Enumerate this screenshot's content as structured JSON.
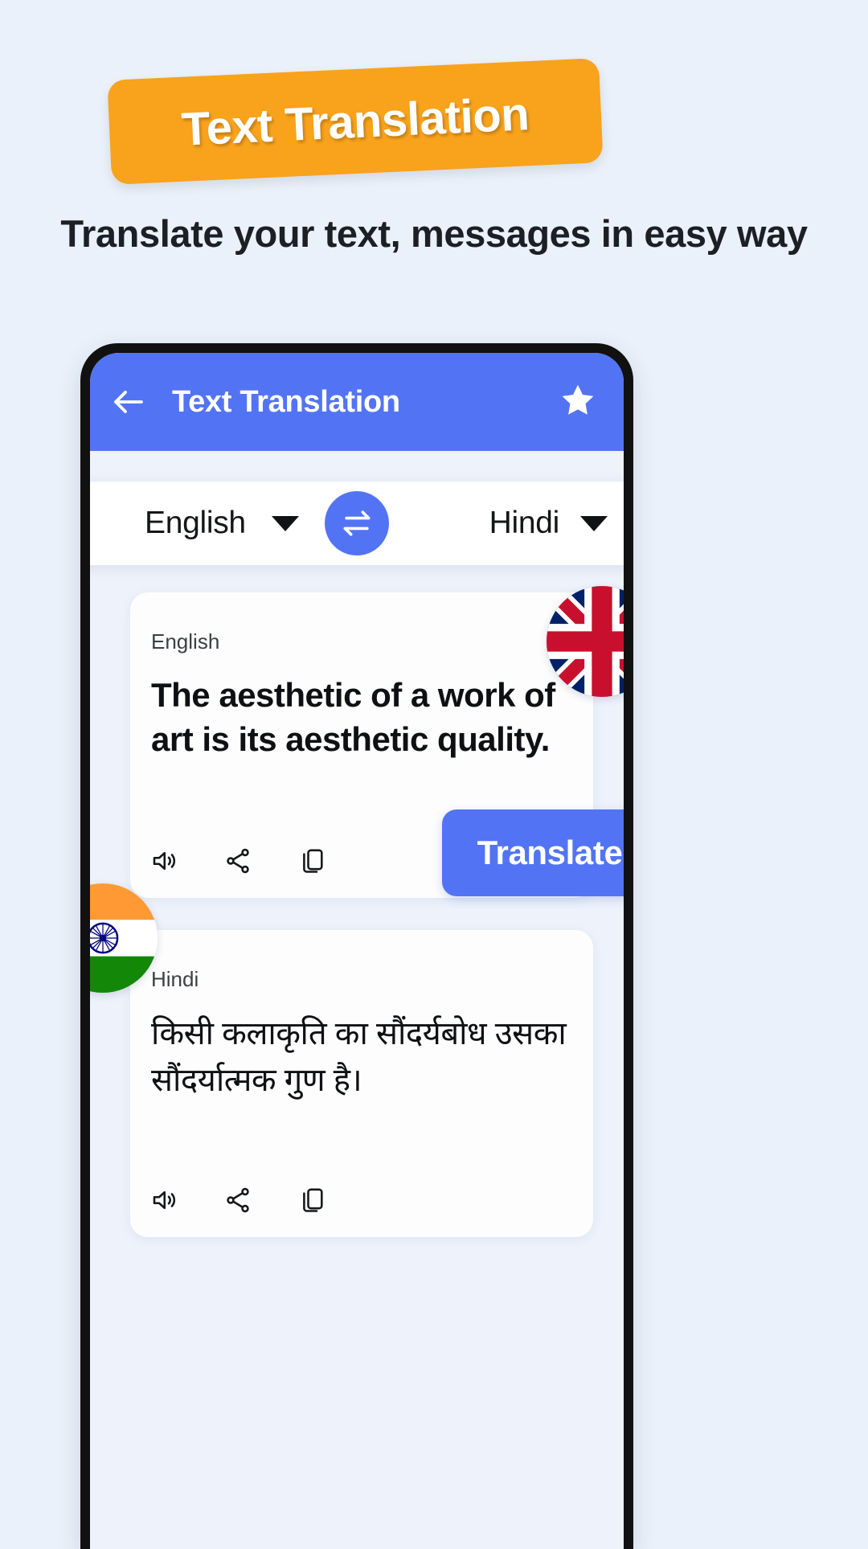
{
  "promo": {
    "banner_title": "Text Translation",
    "subtitle": "Translate your text, messages in easy way",
    "banner_color": "#F9A21B",
    "background_color": "#EAF1FA"
  },
  "app": {
    "accent_color": "#5274F4",
    "app_bar": {
      "title": "Text Translation",
      "back_icon": "back-arrow-icon",
      "favorite_icon": "star-icon"
    },
    "language_bar": {
      "source_language": "English",
      "target_language": "Hindi",
      "swap_icon": "swap-horizontal-icon",
      "source_caret": "chevron-down-icon",
      "target_caret": "chevron-down-icon"
    },
    "source_card": {
      "language_label": "English",
      "text": "The aesthetic of a work of art is its aesthetic quality.",
      "flag": "uk-flag",
      "actions": [
        "speaker-icon",
        "share-icon",
        "copy-icon"
      ]
    },
    "target_card": {
      "language_label": "Hindi",
      "text": "किसी कलाकृति का सौंदर्यबोध उसका सौंदर्यात्मक गुण है।",
      "flag": "india-flag",
      "actions": [
        "speaker-icon",
        "share-icon",
        "copy-icon"
      ]
    },
    "translate_button_label": "Translate"
  }
}
